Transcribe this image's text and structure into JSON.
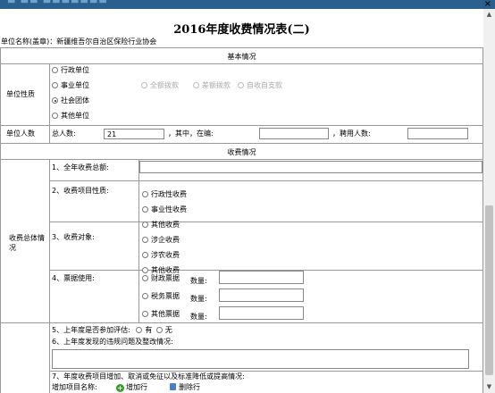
{
  "window": {
    "close_label": "×"
  },
  "page": {
    "title": "2016年度收费情况表(二)",
    "unit_label": "单位名称(盖章)：",
    "unit_value": "新疆维吾尔自治区保险行业协会"
  },
  "basic": {
    "header": "基本情况",
    "nature_label": "单位性质",
    "nature_options": [
      "行政单位",
      "事业单位",
      "社会团体",
      "其他单位"
    ],
    "nature_selected": "社会团体",
    "funding_options": [
      "全额拨款",
      "差额拨款",
      "自收自支款"
    ],
    "staff_label": "单位人数",
    "total_label": "总人数:",
    "total_value": "21",
    "in_staff_label": "，其中，在编:",
    "in_staff_value": "",
    "hired_label": "，聘用人数:",
    "hired_value": ""
  },
  "fees": {
    "header": "收费情况",
    "overall_label": "收费总体情况",
    "item1": "1、全年收费总额:",
    "item1_value": "",
    "item2": "2、收费项目性质:",
    "nature_options": [
      "行政性收费",
      "事业性收费",
      "其他收费"
    ],
    "item3": "3、收费对象:",
    "object_options": [
      "涉企收费",
      "涉农收费",
      "其他收费"
    ],
    "item4": "4、票据使用:",
    "receipt_options": [
      "财政票据",
      "税务票据",
      "其他票据"
    ],
    "quantity_label": "数量:",
    "item5": "5、上年度是否参加评估:",
    "yes_label": "有",
    "no_label": "无",
    "item6": "6、上年度发现的违规问题及整改情况:",
    "item6_value": "",
    "item7": "7、年度收费项目增加、取消或免征以及标准降低或提高情况:",
    "add_project_label": "增加项目名称:",
    "add_row_label": "增加行",
    "delete_row_label": "删除行"
  }
}
